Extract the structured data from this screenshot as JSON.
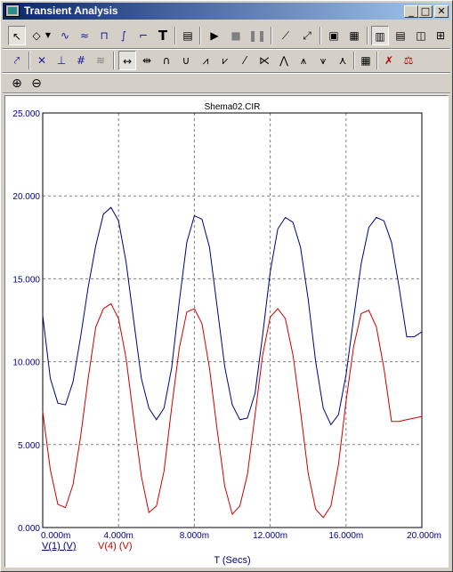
{
  "window": {
    "title": "Transient Analysis",
    "caption_buttons": {
      "minimize": "_",
      "maximize": "□",
      "close": "✕"
    }
  },
  "toolbar": {
    "row1": [
      "select-arrow-icon",
      "scope-select-icon",
      "dropdown-arrow-icon",
      "waveform-icon",
      "ac-wave-icon",
      "peak-icon",
      "slope-icon",
      "marker-icon",
      "text-icon",
      "properties-icon",
      "run-icon",
      "stop-icon",
      "pause-icon",
      "line-tool-icon",
      "curve-tool-icon",
      "frame-icon",
      "grid-icon",
      "vertical-grid-icon",
      "horizontal-grid-icon",
      "half-grid-icon",
      "quarter-grid-icon"
    ],
    "row2": [
      "tangent-icon",
      "cursor-mode-icon",
      "cursor-level-icon",
      "cursor-grid-icon",
      "cursor-cross-icon",
      "left-right-cursor-icon",
      "right-cursor-icon",
      "peak-cursor-icon",
      "valley-cursor-icon",
      "high-cursor-icon",
      "low-cursor-icon",
      "slope-cursor-icon",
      "inflection-cursor-icon",
      "global-high-icon",
      "global-low-icon",
      "table-icon",
      "zoom-x-icon",
      "zoom-y-icon"
    ],
    "row3": [
      "zoom-in-icon",
      "zoom-out-icon"
    ]
  },
  "chart_data": {
    "type": "line",
    "title": "Shema02.CIR",
    "xlabel": "T (Secs)",
    "ylabel": "",
    "xlim": [
      0,
      0.02
    ],
    "ylim": [
      0,
      25
    ],
    "grid": true,
    "x_ticks": [
      "0.000m",
      "4.000m",
      "8.000m",
      "12.000m",
      "16.000m",
      "20.000m"
    ],
    "y_ticks": [
      "0.000",
      "5.000",
      "10.000",
      "15.000",
      "20.000",
      "25.000"
    ],
    "legend_position": "bottom-left",
    "series": [
      {
        "name": "V(1) (V)",
        "color": "#000080",
        "x": [
          0.0,
          0.0004,
          0.0008,
          0.0012,
          0.0016,
          0.002,
          0.0024,
          0.0028,
          0.0032,
          0.0036,
          0.004,
          0.0044,
          0.0048,
          0.0052,
          0.0056,
          0.006,
          0.0064,
          0.0068,
          0.0072,
          0.0076,
          0.008,
          0.0084,
          0.0088,
          0.0092,
          0.0096,
          0.01,
          0.0104,
          0.0108,
          0.0112,
          0.0116,
          0.012,
          0.0124,
          0.0128,
          0.0132,
          0.0136,
          0.014,
          0.0144,
          0.0148,
          0.0152,
          0.0156,
          0.016,
          0.0164,
          0.0168,
          0.0172,
          0.0176,
          0.018,
          0.0184,
          0.0188,
          0.0192,
          0.0196,
          0.02
        ],
        "y": [
          12.8,
          9.0,
          7.5,
          7.4,
          8.8,
          11.5,
          14.5,
          17.0,
          18.9,
          19.3,
          18.5,
          16.0,
          12.5,
          9.0,
          7.2,
          6.5,
          7.2,
          9.6,
          13.6,
          17.2,
          18.8,
          18.6,
          16.9,
          13.3,
          9.7,
          7.4,
          6.5,
          6.6,
          8.1,
          11.6,
          15.4,
          18.0,
          18.7,
          18.4,
          16.9,
          13.8,
          10.0,
          7.2,
          6.2,
          6.8,
          9.2,
          12.6,
          15.9,
          18.1,
          18.7,
          18.5,
          17.2,
          14.5,
          11.5,
          11.5,
          11.8
        ]
      },
      {
        "name": "V(4) (V)",
        "color": "#cc0000",
        "x": [
          0.0,
          0.0004,
          0.0008,
          0.0012,
          0.0016,
          0.002,
          0.0024,
          0.0028,
          0.0032,
          0.0036,
          0.004,
          0.0044,
          0.0048,
          0.0052,
          0.0056,
          0.006,
          0.0064,
          0.0068,
          0.0072,
          0.0076,
          0.008,
          0.0084,
          0.0088,
          0.0092,
          0.0096,
          0.01,
          0.0104,
          0.0108,
          0.0112,
          0.0116,
          0.012,
          0.0124,
          0.0128,
          0.0132,
          0.0136,
          0.014,
          0.0144,
          0.0148,
          0.0152,
          0.0156,
          0.016,
          0.0164,
          0.0168,
          0.0172,
          0.0176,
          0.018,
          0.0184,
          0.0188,
          0.0192,
          0.0196,
          0.02
        ],
        "y": [
          7.0,
          3.5,
          1.4,
          1.2,
          2.6,
          5.5,
          9.0,
          12.1,
          13.2,
          13.5,
          12.6,
          10.2,
          6.6,
          3.1,
          0.9,
          1.3,
          3.4,
          7.2,
          10.8,
          13.0,
          13.2,
          12.3,
          9.6,
          5.9,
          2.5,
          0.8,
          1.3,
          3.2,
          6.8,
          10.4,
          12.7,
          13.2,
          12.6,
          10.4,
          7.0,
          3.3,
          1.1,
          0.6,
          1.3,
          3.8,
          7.6,
          10.9,
          12.9,
          13.1,
          12.1,
          9.6,
          6.4,
          6.4,
          6.5,
          6.6,
          6.7
        ]
      }
    ]
  }
}
